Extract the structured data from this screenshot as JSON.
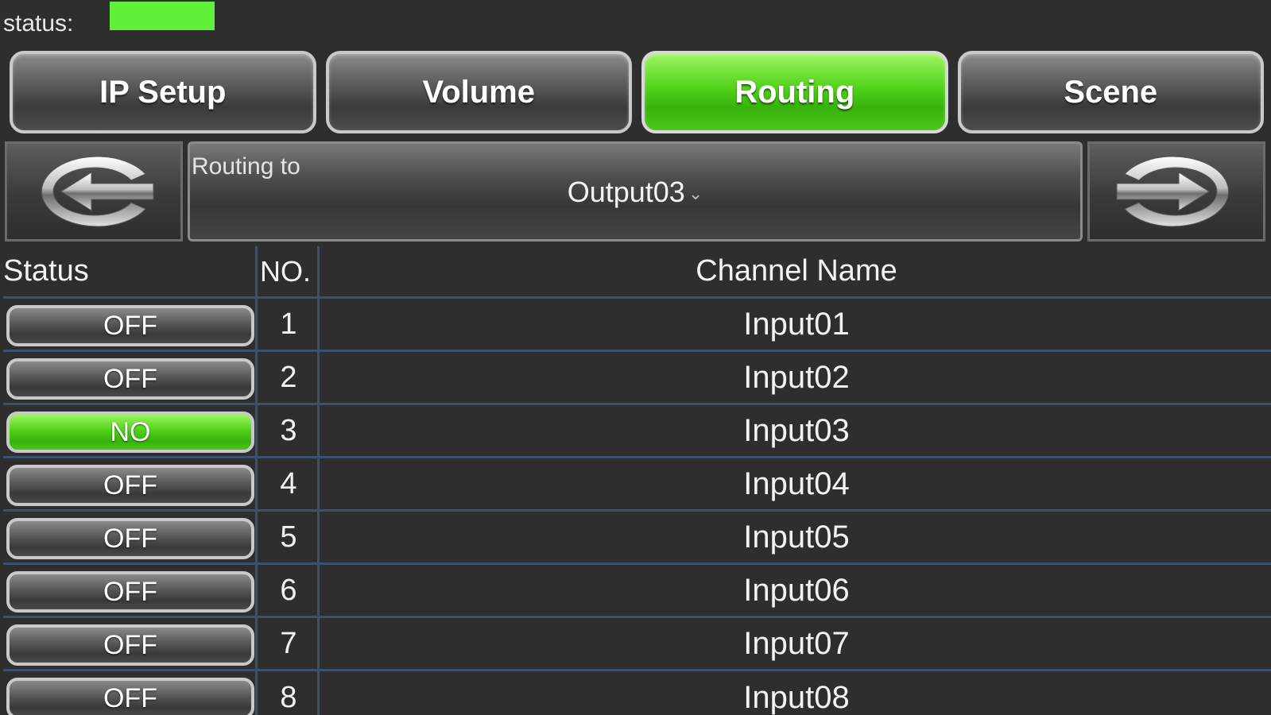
{
  "status_bar": {
    "label": "status:",
    "indicator_color": "#5ff03a"
  },
  "tabs": [
    {
      "label": "IP Setup",
      "active": false
    },
    {
      "label": "Volume",
      "active": false
    },
    {
      "label": "Routing",
      "active": true
    },
    {
      "label": "Scene",
      "active": false
    }
  ],
  "nav": {
    "prev_icon": "arrow-left-icon",
    "next_icon": "arrow-right-icon",
    "routing_label": "Routing to",
    "routing_value": "Output03",
    "dropdown_icon": "chevron-down-icon"
  },
  "table": {
    "headers": {
      "status": "Status",
      "no": "NO.",
      "name": "Channel Name"
    },
    "rows": [
      {
        "status": "OFF",
        "on": false,
        "no": "1",
        "name": "Input01"
      },
      {
        "status": "OFF",
        "on": false,
        "no": "2",
        "name": "Input02"
      },
      {
        "status": "NO",
        "on": true,
        "no": "3",
        "name": "Input03"
      },
      {
        "status": "OFF",
        "on": false,
        "no": "4",
        "name": "Input04"
      },
      {
        "status": "OFF",
        "on": false,
        "no": "5",
        "name": "Input05"
      },
      {
        "status": "OFF",
        "on": false,
        "no": "6",
        "name": "Input06"
      },
      {
        "status": "OFF",
        "on": false,
        "no": "7",
        "name": "Input07"
      },
      {
        "status": "OFF",
        "on": false,
        "no": "8",
        "name": "Input08"
      }
    ]
  },
  "colors": {
    "background": "#2e2e2e",
    "active_green": "#51d21a",
    "grid_line": "#3f4f6e"
  }
}
